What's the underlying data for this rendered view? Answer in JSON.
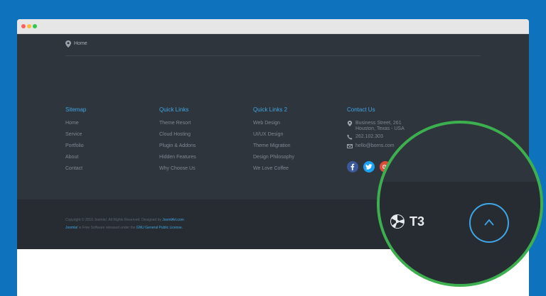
{
  "breadcrumb": {
    "home_label": "Home"
  },
  "footer": {
    "columns": [
      {
        "title": "Sitemap",
        "links": [
          "Home",
          "Service",
          "Portfolio",
          "About",
          "Contact"
        ]
      },
      {
        "title": "Quick Links",
        "links": [
          "Theme Resort",
          "Cloud Hosting",
          "Plugin & Addons",
          "Hidden Features",
          "Why Choose Us"
        ]
      },
      {
        "title": "Quick Links 2",
        "links": [
          "Web Design",
          "UI/UX Design",
          "Theme Migration",
          "Design Philosophy",
          "We Love Coffee"
        ]
      }
    ],
    "contact": {
      "title": "Contact Us",
      "address_line1": "Business Street, 261",
      "address_line2": "Houston, Texas - USA",
      "phone": "262.102.303",
      "email": "hello@borns.com"
    },
    "social": [
      {
        "name": "facebook",
        "color": "#3b5998"
      },
      {
        "name": "twitter",
        "color": "#1da1f2"
      },
      {
        "name": "google-plus",
        "color": "#dd4b39"
      }
    ]
  },
  "copyright": {
    "line1_prefix": "Copyright © 2016 Joomla!. All Rights Reserved. Designed by",
    "line1_link": "JoomlArt.com",
    "line2_link1": "Joomla!",
    "line2_middle": "is Free Software released under the",
    "line2_link2": "GNU General Public License."
  },
  "brand": {
    "t3_label": "T3"
  },
  "colors": {
    "accent": "#3fa5e4",
    "footer_bg": "#2f353d",
    "bottom_bg": "#272c32",
    "magnifier_ring": "#3caf4e",
    "page_bg": "#0f72bd"
  }
}
